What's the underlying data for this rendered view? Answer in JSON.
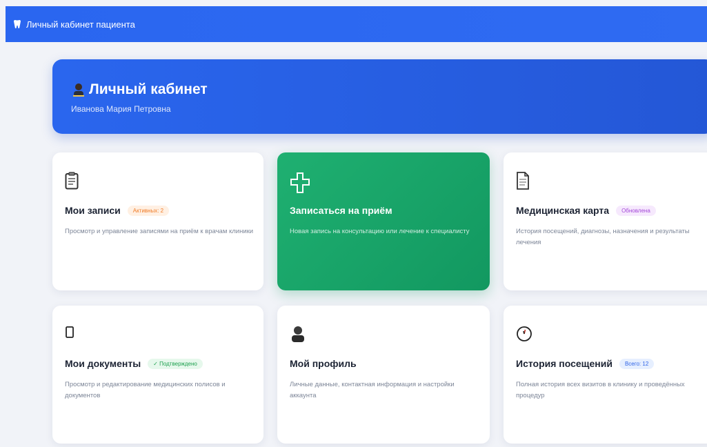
{
  "topbar": {
    "title": "Личный кабинет пациента",
    "icon": "tooth-icon"
  },
  "hero": {
    "title": "Личный кабинет",
    "subtitle": "Иванова Мария Петровна",
    "icon": "user-icon"
  },
  "cards": [
    {
      "id": "appointments",
      "icon": "clipboard-icon",
      "title": "Мои записи",
      "badge": "Активных: 2",
      "badge_color": "#f07b26",
      "description": "Просмотр и управление записями на приём к врачам клиники"
    },
    {
      "id": "book",
      "icon": "plus-icon",
      "title": "Записаться на приём",
      "badge": "",
      "description": "Новая запись на консультацию или лечение к специалисту",
      "accent": "#1fb071"
    },
    {
      "id": "medical-card",
      "icon": "document-icon",
      "title": "Медицинская карта",
      "badge": "Обновлена",
      "badge_color": "#a447d8",
      "description": "История посещений, диагнозы, назначения и результаты лечения"
    },
    {
      "id": "documents",
      "icon": "phone-icon",
      "title": "Мои документы",
      "badge": "✓ Подтверждено",
      "badge_color": "#1fa050",
      "description": "Просмотр и редактирование медицинских полисов и документов"
    },
    {
      "id": "profile",
      "icon": "user-icon",
      "title": "Мой профиль",
      "badge": "",
      "description": "Личные данные, контактная информация и настройки аккаунта"
    },
    {
      "id": "history",
      "icon": "clock-icon",
      "title": "История посещений",
      "badge": "Всего: 12",
      "badge_color": "#2f64e6",
      "description": "Полная история всех визитов в клинику и проведённых процедур"
    }
  ],
  "colors": {
    "primary": "#2a66f0",
    "accent_green": "#1fb071",
    "background": "#f1f3f8"
  }
}
